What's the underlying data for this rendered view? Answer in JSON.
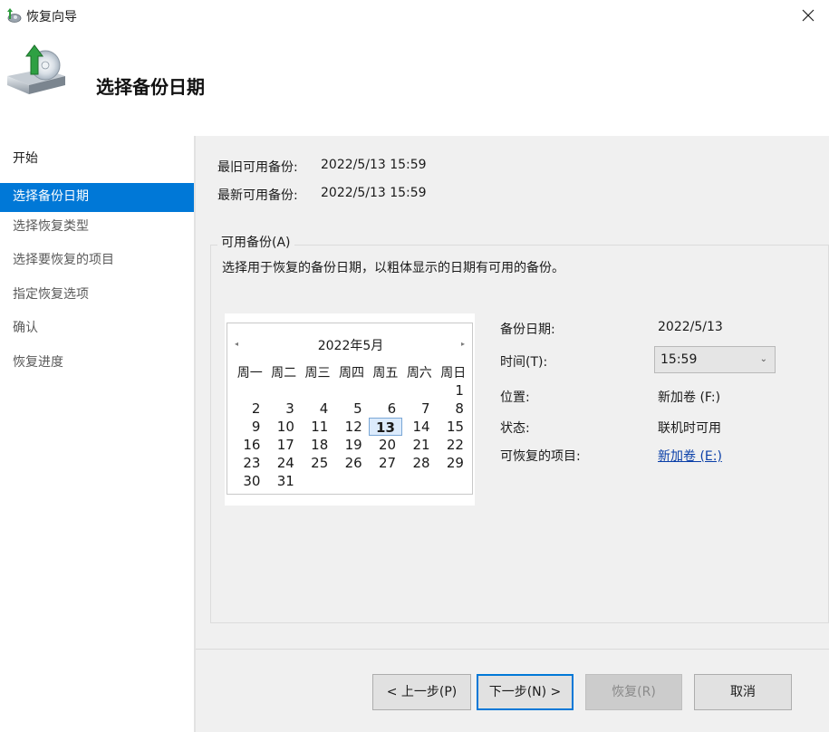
{
  "window": {
    "title": "恢复向导"
  },
  "header": {
    "title": "选择备份日期"
  },
  "sidebar": {
    "items": [
      {
        "label": "开始"
      },
      {
        "label": "选择备份日期"
      },
      {
        "label": "选择恢复类型"
      },
      {
        "label": "选择要恢复的项目"
      },
      {
        "label": "指定恢复选项"
      },
      {
        "label": "确认"
      },
      {
        "label": "恢复进度"
      }
    ]
  },
  "info": {
    "oldest_label": "最旧可用备份:",
    "oldest_value": "2022/5/13 15:59",
    "newest_label": "最新可用备份:",
    "newest_value": "2022/5/13 15:59"
  },
  "group": {
    "legend": "可用备份(A)",
    "description": "选择用于恢复的备份日期，以粗体显示的日期有可用的备份。"
  },
  "calendar": {
    "title": "2022年5月",
    "weekdays": [
      "周一",
      "周二",
      "周三",
      "周四",
      "周五",
      "周六",
      "周日"
    ],
    "rows": [
      [
        "",
        "",
        "",
        "",
        "",
        "",
        "1"
      ],
      [
        "2",
        "3",
        "4",
        "5",
        "6",
        "7",
        "8"
      ],
      [
        "9",
        "10",
        "11",
        "12",
        "13",
        "14",
        "15"
      ],
      [
        "16",
        "17",
        "18",
        "19",
        "20",
        "21",
        "22"
      ],
      [
        "23",
        "24",
        "25",
        "26",
        "27",
        "28",
        "29"
      ],
      [
        "30",
        "31",
        "",
        "",
        "",
        "",
        ""
      ]
    ],
    "selected": "13",
    "prev_glyph": "◂",
    "next_glyph": "▸"
  },
  "details": {
    "date_label": "备份日期:",
    "date_value": "2022/5/13",
    "time_label": "时间(T):",
    "time_value": "15:59",
    "location_label": "位置:",
    "location_value": "新加卷 (F:)",
    "status_label": "状态:",
    "status_value": "联机时可用",
    "items_label": "可恢复的项目:",
    "items_link": "新加卷 (E:)"
  },
  "buttons": {
    "back": "< 上一步(P)",
    "next": "下一步(N) >",
    "recover": "恢复(R)",
    "cancel": "取消"
  }
}
